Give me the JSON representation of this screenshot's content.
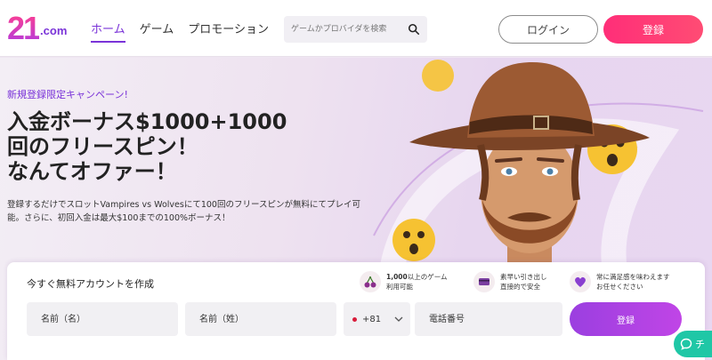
{
  "header": {
    "logo_main": "21",
    "logo_suffix": ".com",
    "nav": [
      {
        "label": "ホーム",
        "active": true
      },
      {
        "label": "ゲーム",
        "active": false
      },
      {
        "label": "プロモーション",
        "active": false
      }
    ],
    "search_placeholder": "ゲームかプロバイダを検索",
    "login_label": "ログイン",
    "register_label": "登録"
  },
  "hero": {
    "campaign": "新規登録限定キャンペーン!",
    "headline_lines": [
      "入金ボーナス$1000+1000",
      "回のフリースピン！",
      "なんてオファー！"
    ],
    "subtext": "登録するだけでスロットVampires vs Wolvesにて100回のフリースピンが無料にてプレイ可能。さらに、初回入金は最大$100までの100%ボーナス！"
  },
  "registration": {
    "title": "今すぐ無料アカウントを作成",
    "features": [
      {
        "icon": "cherries-icon",
        "bold": "1,000",
        "line1_rest": "以上のゲーム",
        "line2": "利用可能"
      },
      {
        "icon": "cards-icon",
        "bold": "",
        "line1_rest": "素早い引き出し",
        "line2": "直接的で安全"
      },
      {
        "icon": "heart-icon",
        "bold": "",
        "line1_rest": "常に満足感を味わえます",
        "line2": "お任せください"
      }
    ],
    "first_name_placeholder": "名前（名）",
    "last_name_placeholder": "名前（姓）",
    "phone_code": "+81",
    "phone_placeholder": "電話番号",
    "submit_label": "登録"
  },
  "chat": {
    "label": "チ"
  },
  "colors": {
    "brand_purple": "#7a33d8",
    "register_pink": "#ff2e78",
    "chat_green": "#1fc7a6"
  }
}
